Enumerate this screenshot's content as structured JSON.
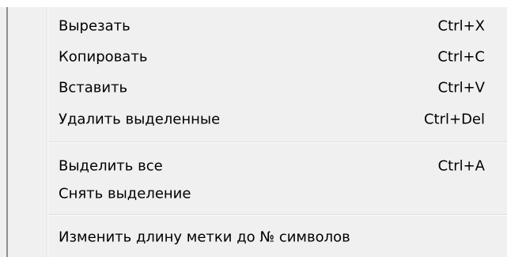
{
  "context_menu": {
    "groups": [
      {
        "items": [
          {
            "label": "Вырезать",
            "shortcut": "Ctrl+X"
          },
          {
            "label": "Копировать",
            "shortcut": "Ctrl+C"
          },
          {
            "label": "Вставить",
            "shortcut": "Ctrl+V"
          },
          {
            "label": "Удалить выделенные",
            "shortcut": "Ctrl+Del"
          }
        ]
      },
      {
        "items": [
          {
            "label": "Выделить все",
            "shortcut": "Ctrl+A"
          },
          {
            "label": "Снять выделение",
            "shortcut": ""
          }
        ]
      },
      {
        "items": [
          {
            "label": "Изменить длину метки до № символов",
            "shortcut": ""
          }
        ]
      }
    ]
  }
}
